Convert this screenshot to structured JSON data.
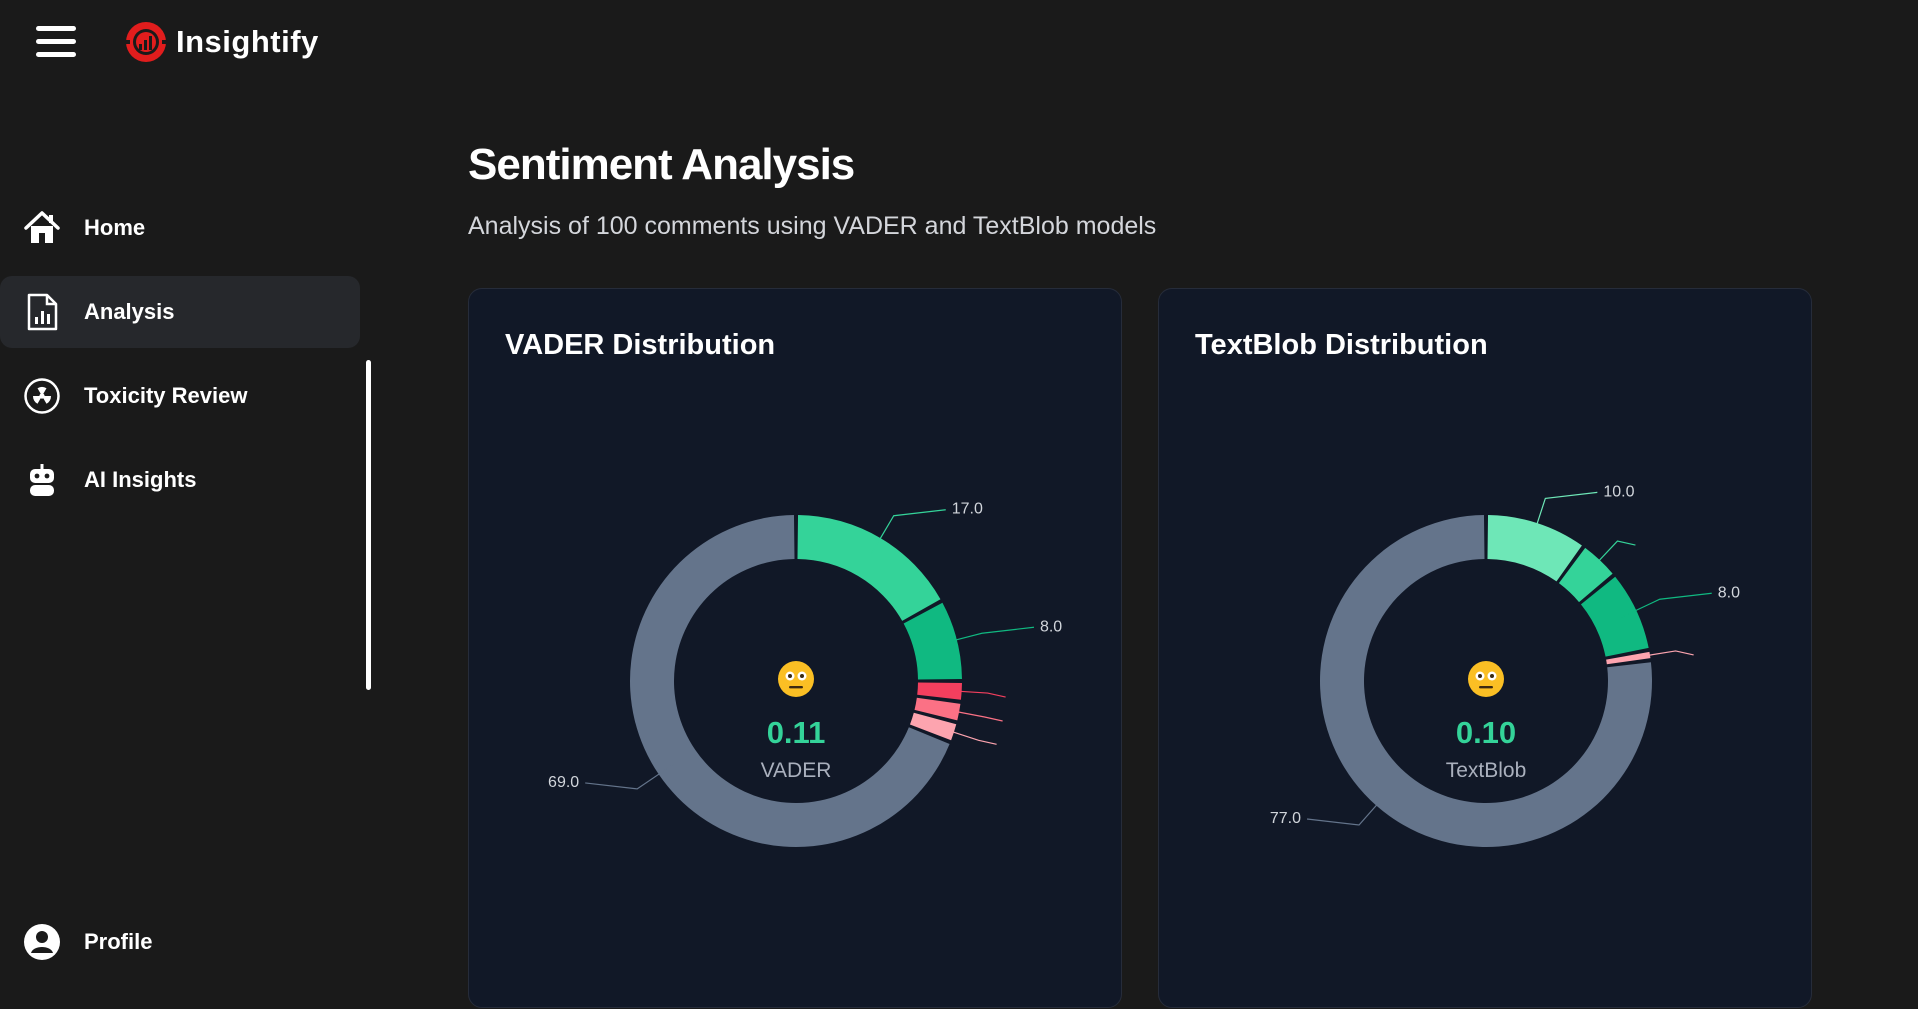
{
  "app": {
    "name": "Insightify"
  },
  "header": {
    "menu_icon": "hamburger-icon",
    "logo_icon": "chart-target-logo-icon"
  },
  "sidebar": {
    "items": [
      {
        "label": "Home",
        "icon": "home-icon",
        "active": false
      },
      {
        "label": "Analysis",
        "icon": "report-chart-icon",
        "active": true
      },
      {
        "label": "Toxicity Review",
        "icon": "radiation-icon",
        "active": false
      },
      {
        "label": "AI Insights",
        "icon": "robot-icon",
        "active": false
      }
    ],
    "profile": {
      "label": "Profile",
      "icon": "user-circle-icon"
    }
  },
  "main": {
    "title": "Sentiment Analysis",
    "subtitle": "Analysis of 100 comments using VADER and TextBlob models"
  },
  "colors": {
    "neutral": "#64748b",
    "positive_light": "#6ee7b7",
    "positive": "#34d399",
    "positive_dark": "#10b981",
    "negative": "#f43f5e",
    "negative_light": "#fb7185",
    "negative_pale": "#fda4af",
    "card_bg": "#111827"
  },
  "chart_data": [
    {
      "type": "pie",
      "variant": "donut",
      "title": "VADER Distribution",
      "center_emoji": "neutral-face-emoji",
      "center_value": "0.11",
      "center_label": "VADER",
      "slices": [
        {
          "value": 17,
          "label": "17.0",
          "color": "#34d399"
        },
        {
          "value": 8,
          "label": "8.0",
          "color": "#10b981"
        },
        {
          "value": 2,
          "label": "",
          "color": "#f43f5e"
        },
        {
          "value": 2,
          "label": "",
          "color": "#fb7185"
        },
        {
          "value": 2,
          "label": "",
          "color": "#fda4af"
        },
        {
          "value": 69,
          "label": "69.0",
          "color": "#64748b"
        }
      ]
    },
    {
      "type": "pie",
      "variant": "donut",
      "title": "TextBlob Distribution",
      "center_emoji": "neutral-face-emoji",
      "center_value": "0.10",
      "center_label": "TextBlob",
      "slices": [
        {
          "value": 10,
          "label": "10.0",
          "color": "#6ee7b7"
        },
        {
          "value": 4,
          "label": "",
          "color": "#34d399"
        },
        {
          "value": 8,
          "label": "8.0",
          "color": "#10b981"
        },
        {
          "value": 1,
          "label": "",
          "color": "#fda4af"
        },
        {
          "value": 77,
          "label": "77.0",
          "color": "#64748b"
        }
      ]
    }
  ]
}
